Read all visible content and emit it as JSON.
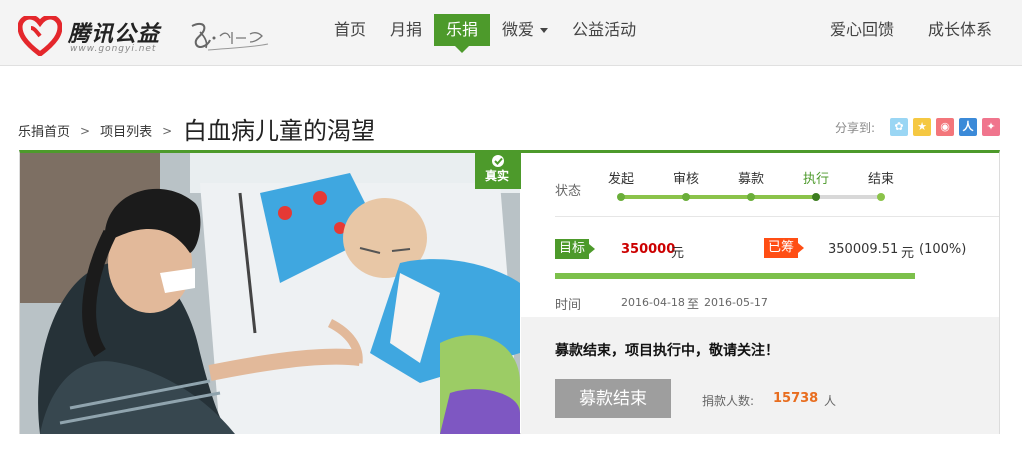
{
  "brand": {
    "name": "腾讯公益",
    "url": "www.gongyi.net",
    "slogan": "爱·在一起"
  },
  "nav": {
    "items": [
      {
        "label": "首页",
        "active": false
      },
      {
        "label": "月捐",
        "active": false
      },
      {
        "label": "乐捐",
        "active": true
      },
      {
        "label": "微爱",
        "active": false,
        "dropdown": true
      },
      {
        "label": "公益活动",
        "active": false
      }
    ],
    "right": [
      {
        "label": "爱心回馈"
      },
      {
        "label": "成长体系"
      }
    ]
  },
  "breadcrumb": {
    "items": [
      "乐捐首页",
      "项目列表"
    ],
    "separator": ">"
  },
  "page_title": "白血病儿童的渴望",
  "share": {
    "label": "分享到:",
    "icons": [
      {
        "name": "qzone-icon",
        "color": "#9ad6f4"
      },
      {
        "name": "pengyou-icon",
        "color": "#f5c842"
      },
      {
        "name": "weibo-icon",
        "color": "#f3767b"
      },
      {
        "name": "renren-icon",
        "color": "#3b8ad8"
      },
      {
        "name": "kaixin-icon",
        "color": "#f0758d"
      }
    ]
  },
  "verified_badge": "真实",
  "status": {
    "label": "状态",
    "steps": [
      "发起",
      "审核",
      "募款",
      "执行",
      "结束"
    ],
    "current_index": 3
  },
  "goal": {
    "tag": "目标",
    "value": "350000",
    "unit": "元"
  },
  "raised": {
    "tag": "已筹",
    "value": "350009.51",
    "unit": "元",
    "percent_text": "(100%)",
    "progress": 1.0
  },
  "time": {
    "label": "时间",
    "start": "2016-04-18",
    "separator": "至",
    "end": "2016-05-17"
  },
  "notice": "募款结束，项目执行中，敬请关注！",
  "end_button": "募款结束",
  "donors": {
    "label": "捐款人数:",
    "value": "15738",
    "unit": "人"
  },
  "colors": {
    "accent": "#4d9a2b",
    "raised_tag": "#ff4e14",
    "goal_value": "#cc0000",
    "donors_value": "#e86d1f"
  }
}
